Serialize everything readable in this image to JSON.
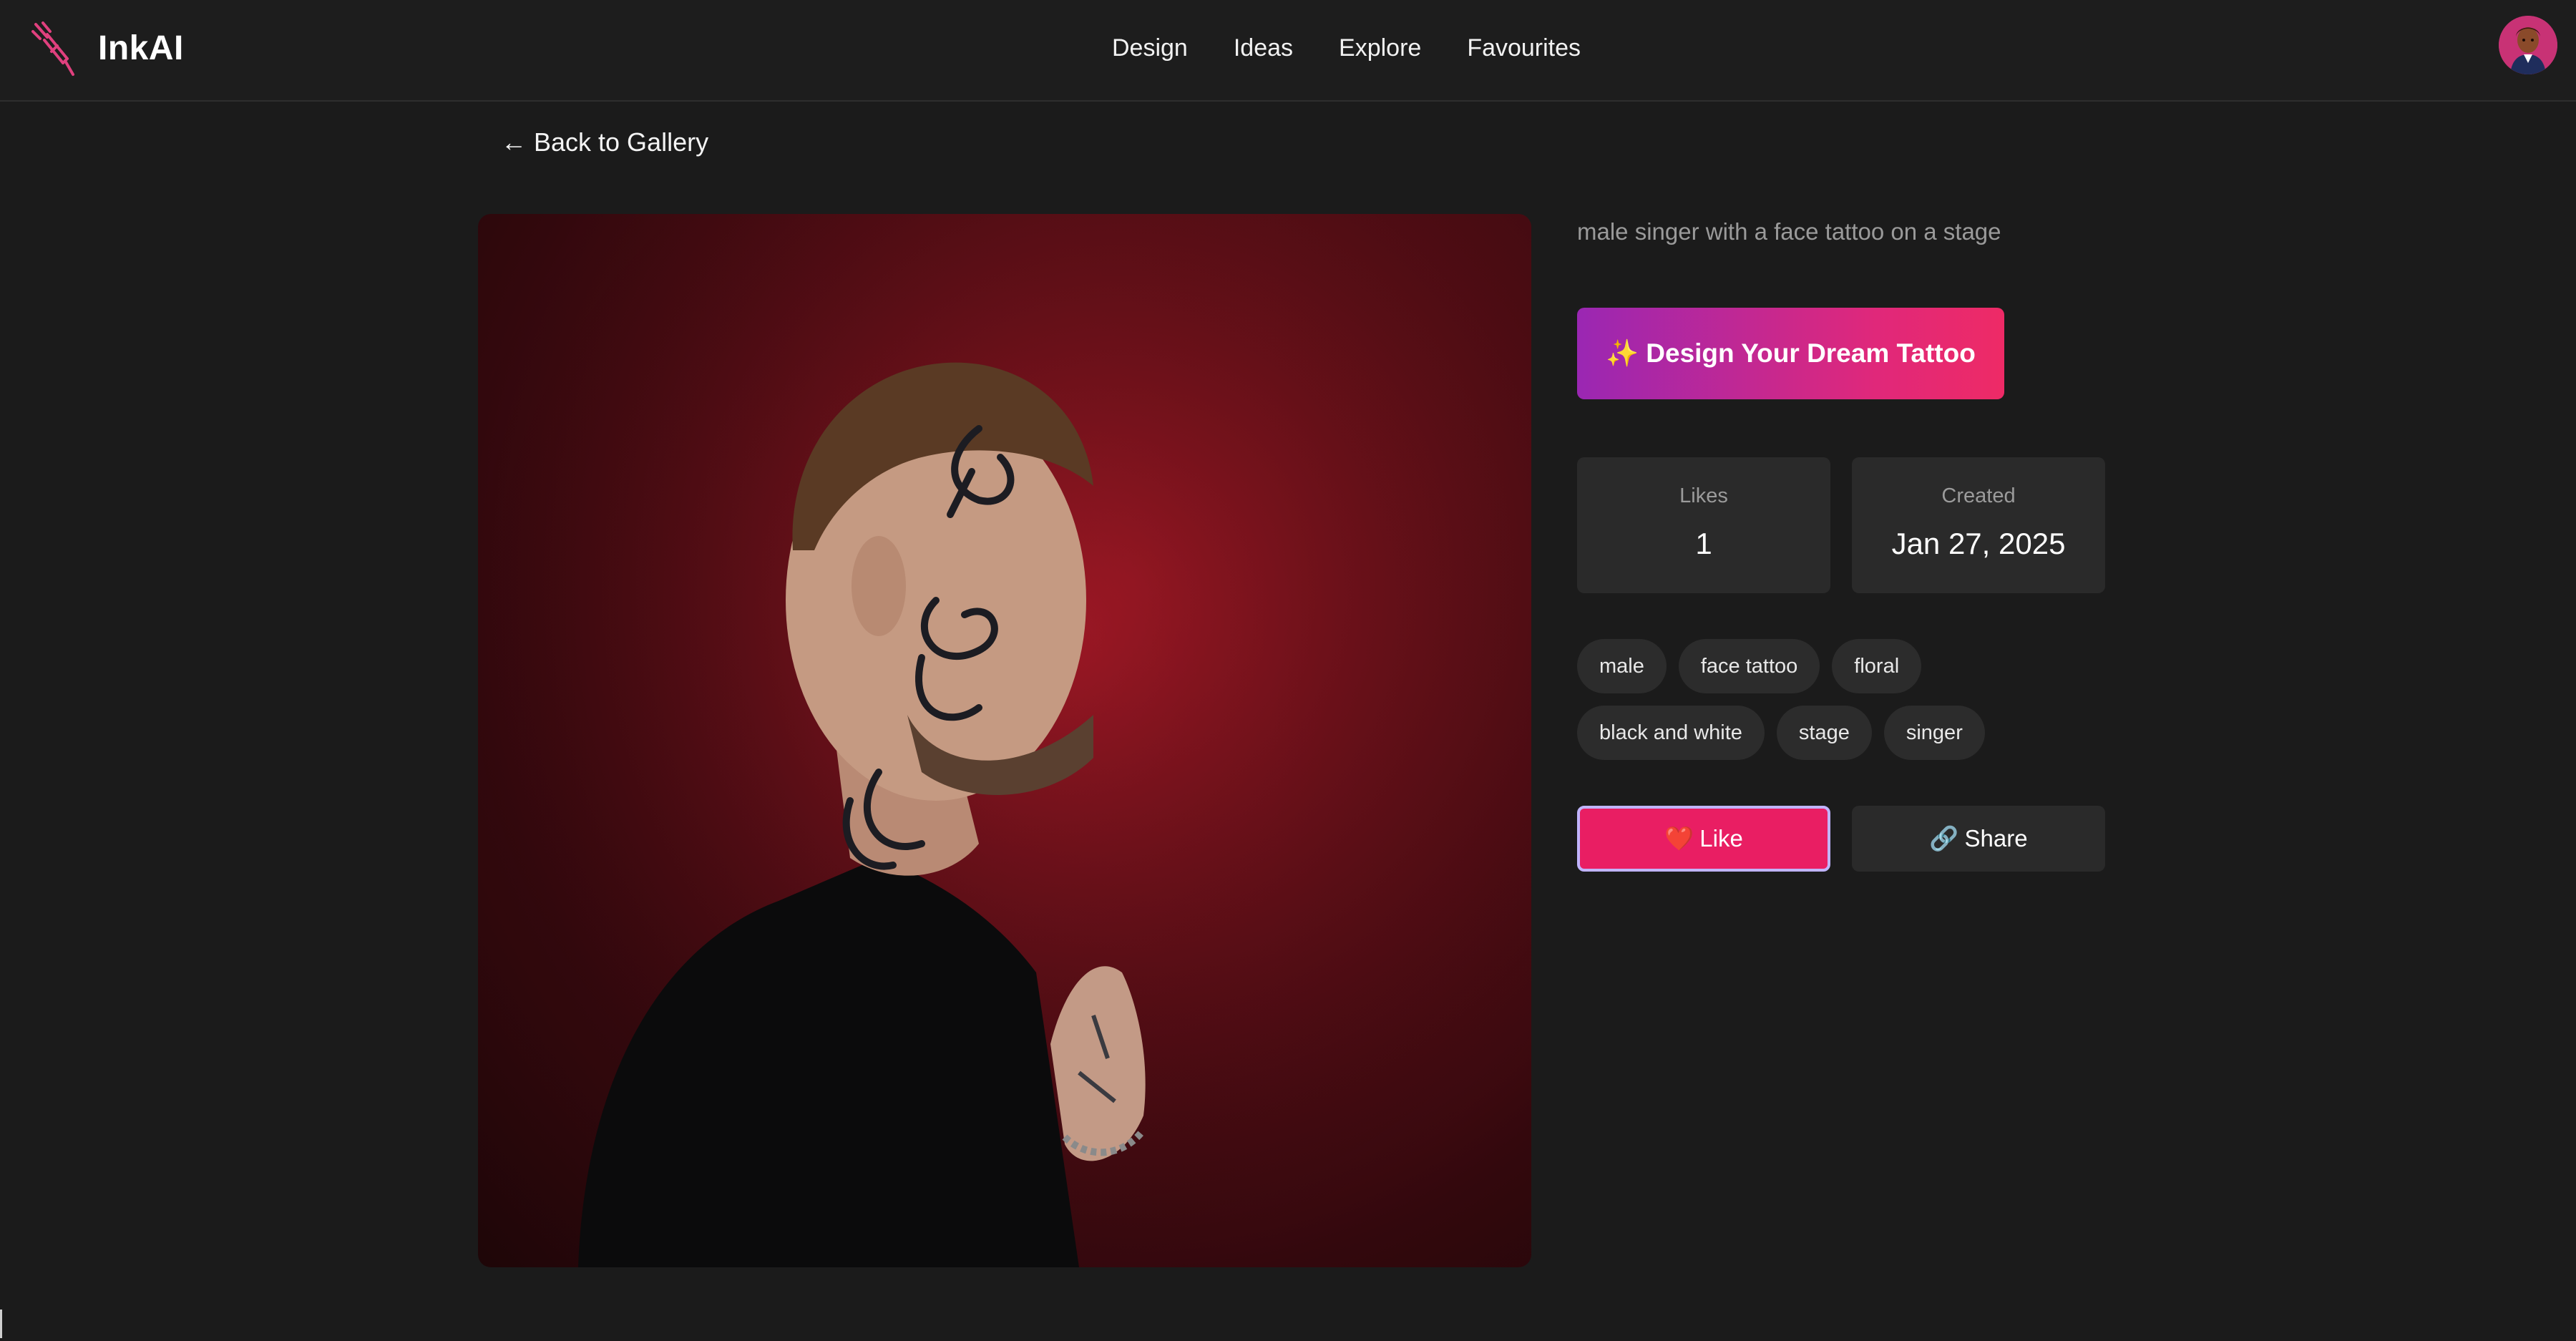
{
  "app": {
    "name": "InkAI"
  },
  "nav": {
    "items": [
      "Design",
      "Ideas",
      "Explore",
      "Favourites"
    ]
  },
  "page": {
    "back_label": "Back to Gallery",
    "prompt": "male singer with a face tattoo on a stage",
    "cta_label": "Design Your Dream Tattoo",
    "stats": {
      "likes_label": "Likes",
      "likes_value": "1",
      "created_label": "Created",
      "created_value": "Jan 27, 2025"
    },
    "tags": [
      "male",
      "face tattoo",
      "floral",
      "black and white",
      "stage",
      "singer"
    ],
    "like_label": "Like",
    "share_label": "Share"
  },
  "icons": {
    "logo": "tattoo-needle-icon",
    "back": "arrow-left-icon",
    "cta": "sparkles-icon",
    "like": "heart-icon",
    "share": "link-icon"
  },
  "colors": {
    "background": "#1b1b1b",
    "accent": "#e91e63",
    "cta_start": "#9a27b3",
    "cta_end": "#ee2a66",
    "card": "#2a2a2a"
  }
}
